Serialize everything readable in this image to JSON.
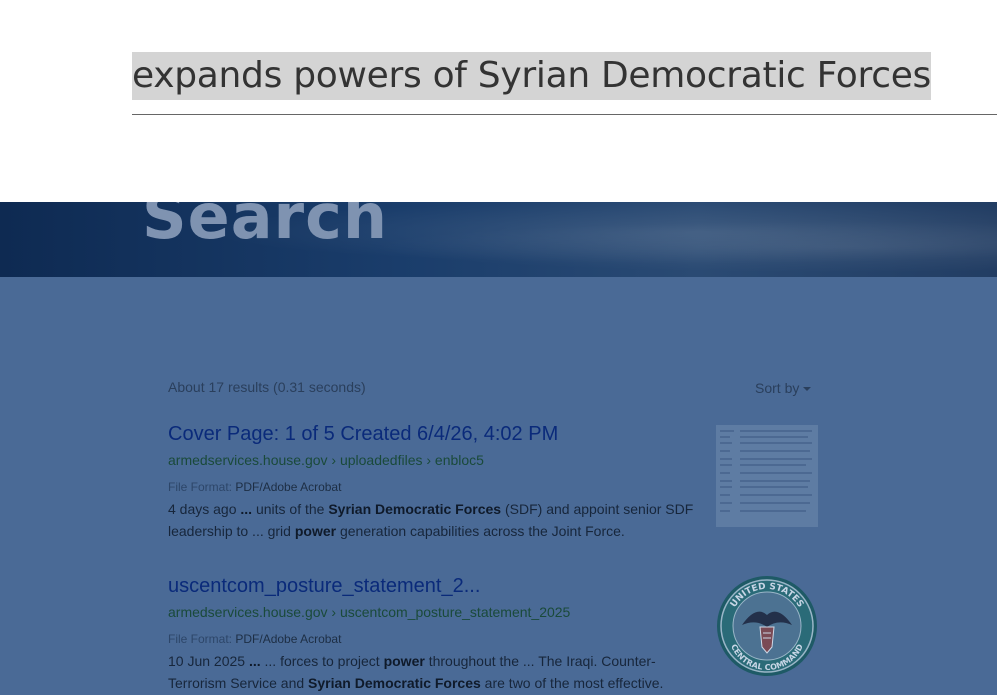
{
  "search": {
    "query": "expands powers of Syrian Democratic Forces"
  },
  "hero": {
    "title": "Search"
  },
  "results_meta": {
    "count_text": "About 17 results (0.31 seconds)",
    "sort_label": "Sort by"
  },
  "results": [
    {
      "title": "Cover Page: 1 of 5 Created 6/4/26, 4:02 PM",
      "url": "armedservices.house.gov › uploadedfiles › enbloc5",
      "file_format_label": "File Format:",
      "file_format": "PDF/Adobe Acrobat",
      "snippet_parts": [
        {
          "t": "4 days ago ",
          "b": false
        },
        {
          "t": "...",
          "b": true
        },
        {
          "t": " units of the ",
          "b": false
        },
        {
          "t": "Syrian Democratic Forces",
          "b": true
        },
        {
          "t": " (SDF) and appoint senior SDF leadership to ... grid ",
          "b": false
        },
        {
          "t": "power",
          "b": true
        },
        {
          "t": " generation capabilities across the Joint Force.",
          "b": false
        }
      ],
      "thumbnail": "document-thumbnail"
    },
    {
      "title": "uscentcom_posture_statement_2...",
      "url": "armedservices.house.gov › uscentcom_posture_statement_2025",
      "file_format_label": "File Format:",
      "file_format": "PDF/Adobe Acrobat",
      "snippet_parts": [
        {
          "t": "10 Jun 2025 ",
          "b": false
        },
        {
          "t": "...",
          "b": true
        },
        {
          "t": " ... forces to project ",
          "b": false
        },
        {
          "t": "power",
          "b": true
        },
        {
          "t": " throughout the ... The Iraqi. Counter-Terrorism Service and ",
          "b": false
        },
        {
          "t": "Syrian Democratic Forces",
          "b": true
        },
        {
          "t": " are two of the most effective.",
          "b": false
        }
      ],
      "thumbnail": "seal-icon",
      "seal_text_top": "UNITED STATES",
      "seal_text_bottom": "CENTRAL COMMAND"
    }
  ],
  "colors": {
    "overlay": "#4a6a96",
    "link": "#0a2a7a",
    "url": "#1a4a3a"
  }
}
